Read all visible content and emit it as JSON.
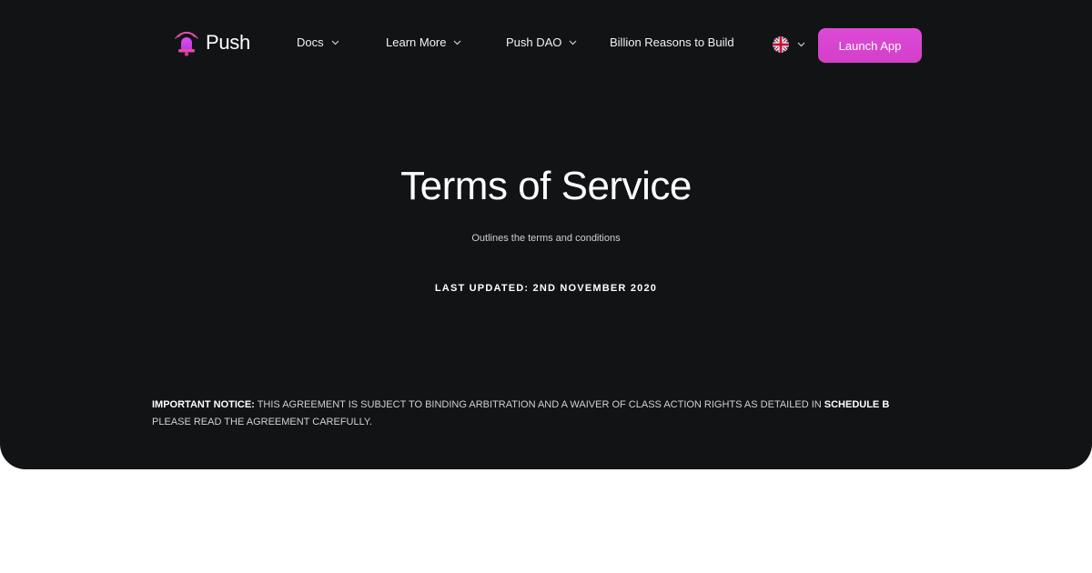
{
  "brand": {
    "name": "Push",
    "logo_icon": "bell-icon",
    "accent": "#d548ec"
  },
  "nav": {
    "items": [
      {
        "label": "Docs",
        "has_dropdown": true
      },
      {
        "label": "Learn More",
        "has_dropdown": true
      },
      {
        "label": "Push DAO",
        "has_dropdown": true
      },
      {
        "label": "Billion Reasons to Build",
        "has_dropdown": false
      }
    ],
    "language_icon": "uk-flag-icon",
    "cta_label": "Launch App"
  },
  "hero": {
    "title": "Terms of Service",
    "subtitle": "Outlines the terms and conditions",
    "last_updated": "LAST UPDATED: 2ND NOVEMBER 2020"
  },
  "notice": {
    "lead": "IMPORTANT NOTICE:",
    "body": " THIS AGREEMENT IS SUBJECT TO BINDING ARBITRATION AND A WAIVER OF CLASS ACTION RIGHTS AS DETAILED IN ",
    "link": "SCHEDULE B",
    "line2": "PLEASE READ THE AGREEMENT CAREFULLY."
  },
  "colors": {
    "background_dark": "#121315",
    "page": "#ffffff",
    "button": "#d548ec"
  }
}
